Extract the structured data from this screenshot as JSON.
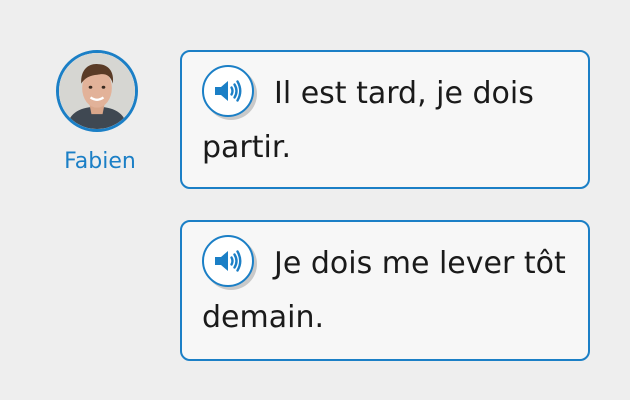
{
  "speaker": {
    "name": "Fabien",
    "avatar_icon": "person-photo",
    "accent_color": "#1b7fc6"
  },
  "messages": [
    {
      "audio_icon": "speaker-volume-icon",
      "text": "Il est tard, je dois partir."
    },
    {
      "audio_icon": "speaker-volume-icon",
      "text": "Je dois me lever tôt demain."
    }
  ]
}
